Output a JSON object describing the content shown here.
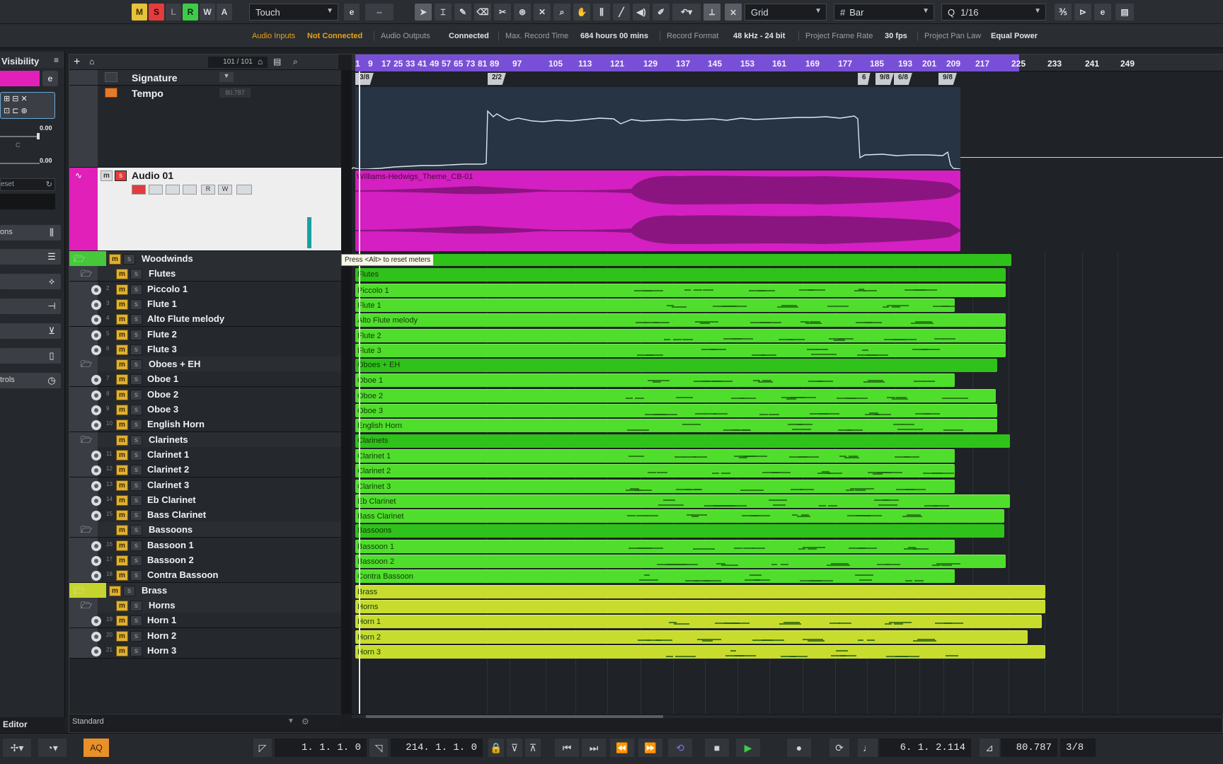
{
  "toolbar": {
    "mode_buttons": [
      {
        "label": "M",
        "bg": "#e7c33a",
        "fg": "#3a2a00"
      },
      {
        "label": "S",
        "bg": "#e23c3c",
        "fg": "#3a0000"
      },
      {
        "label": "L",
        "bg": "#3a3e44",
        "fg": "#888"
      },
      {
        "label": "R",
        "bg": "#3ecb4a",
        "fg": "#0a2a0a"
      },
      {
        "label": "W",
        "bg": "#3a3e44",
        "fg": "#d8dbe0"
      },
      {
        "label": "A",
        "bg": "#3a3e44",
        "fg": "#d8dbe0"
      }
    ],
    "automation_mode": "Touch",
    "snap_type": "Grid",
    "grid_type": "Bar",
    "quantize": "1/16"
  },
  "status": {
    "audio_inputs_label": "Audio Inputs",
    "audio_inputs_value": "Not Connected",
    "audio_outputs_label": "Audio Outputs",
    "audio_outputs_value": "Connected",
    "max_record_label": "Max. Record Time",
    "max_record_value": "684 hours 00 mins",
    "record_format_label": "Record Format",
    "record_format_value": "48 kHz - 24 bit",
    "frame_rate_label": "Project Frame Rate",
    "frame_rate_value": "30 fps",
    "pan_law_label": "Project Pan Law",
    "pan_law_value": "Equal Power"
  },
  "inspector": {
    "title": "Visibility",
    "val1": "0.00",
    "val2": "0.00",
    "preset": "eset",
    "sec1": "ons",
    "sec2": "trols",
    "editor_tab": "Editor"
  },
  "tracklist": {
    "counter": "101 / 101",
    "footer": "Standard",
    "tooltip": "Press <Alt> to reset meters",
    "signature_track": "Signature",
    "tempo_track": "Tempo",
    "tempo_value": "80.787",
    "audio_track": "Audio 01",
    "audio_clip": "Williams-Hedwigs_Theme_CB-01",
    "tracks": [
      {
        "name": "Woodwinds",
        "num": "",
        "type": "folder0"
      },
      {
        "name": "Flutes",
        "num": "",
        "type": "folder1"
      },
      {
        "name": "Piccolo 1",
        "num": "2",
        "type": "inst"
      },
      {
        "name": "Flute 1",
        "num": "3",
        "type": "inst"
      },
      {
        "name": "Alto Flute melody",
        "num": "4",
        "type": "inst"
      },
      {
        "name": "Flute 2",
        "num": "5",
        "type": "inst"
      },
      {
        "name": "Flute 3",
        "num": "6",
        "type": "inst"
      },
      {
        "name": "Oboes + EH",
        "num": "",
        "type": "folder1"
      },
      {
        "name": "Oboe 1",
        "num": "7",
        "type": "inst"
      },
      {
        "name": "Oboe 2",
        "num": "8",
        "type": "inst"
      },
      {
        "name": "Oboe 3",
        "num": "9",
        "type": "inst"
      },
      {
        "name": "English Horn",
        "num": "10",
        "type": "inst"
      },
      {
        "name": "Clarinets",
        "num": "",
        "type": "folder1"
      },
      {
        "name": "Clarinet 1",
        "num": "11",
        "type": "inst"
      },
      {
        "name": "Clarinet 2",
        "num": "12",
        "type": "inst"
      },
      {
        "name": "Clarinet 3",
        "num": "13",
        "type": "inst"
      },
      {
        "name": "Eb Clarinet",
        "num": "14",
        "type": "inst"
      },
      {
        "name": "Bass Clarinet",
        "num": "15",
        "type": "inst"
      },
      {
        "name": "Bassoons",
        "num": "",
        "type": "folder1"
      },
      {
        "name": "Bassoon 1",
        "num": "16",
        "type": "inst"
      },
      {
        "name": "Bassoon 2",
        "num": "17",
        "type": "inst"
      },
      {
        "name": "Contra Bassoon",
        "num": "18",
        "type": "inst"
      },
      {
        "name": "Brass",
        "num": "",
        "type": "folder0b"
      },
      {
        "name": "Horns",
        "num": "",
        "type": "folder1b"
      },
      {
        "name": "Horn 1",
        "num": "19",
        "type": "instb"
      },
      {
        "name": "Horn 2",
        "num": "20",
        "type": "instb"
      },
      {
        "name": "Horn 3",
        "num": "21",
        "type": "instb"
      }
    ]
  },
  "arrange": {
    "parts": [
      "Flutes",
      "Piccolo 1",
      "Flute 1",
      "Alto Flute melody",
      "Flute 2",
      "Flute 3",
      "Oboes + EH",
      "Oboe 1",
      "Oboe 2",
      "Oboe 3",
      "English Horn",
      "Clarinets",
      "Clarinet 1",
      "Clarinet 2",
      "Clarinet 3",
      "Eb Clarinet",
      "Bass Clarinet",
      "Bassoons",
      "Bassoon 1",
      "Bassoon 2",
      "Contra Bassoon",
      "Brass",
      "Horns",
      "Horn 1",
      "Horn 2",
      "Horn 3"
    ],
    "signature_events": [
      "3/8",
      "2/2",
      "6",
      "9/8",
      "6/8",
      "9/8"
    ]
  },
  "ruler": {
    "labels": [
      "1",
      "9",
      "17",
      "25",
      "33",
      "41",
      "49",
      "57",
      "65",
      "73",
      "81",
      "89",
      "97",
      "105",
      "113",
      "121",
      "129",
      "137",
      "145",
      "153",
      "161",
      "169",
      "177",
      "185",
      "193",
      "201",
      "209",
      "217",
      "225",
      "233",
      "241",
      "249"
    ]
  },
  "transport": {
    "left_locator": "1. 1. 1. 0",
    "right_locator": "214. 1. 1. 0",
    "position": "6. 1. 2.114",
    "tempo": "80.787",
    "signature": "3/8",
    "aq": "AQ"
  }
}
